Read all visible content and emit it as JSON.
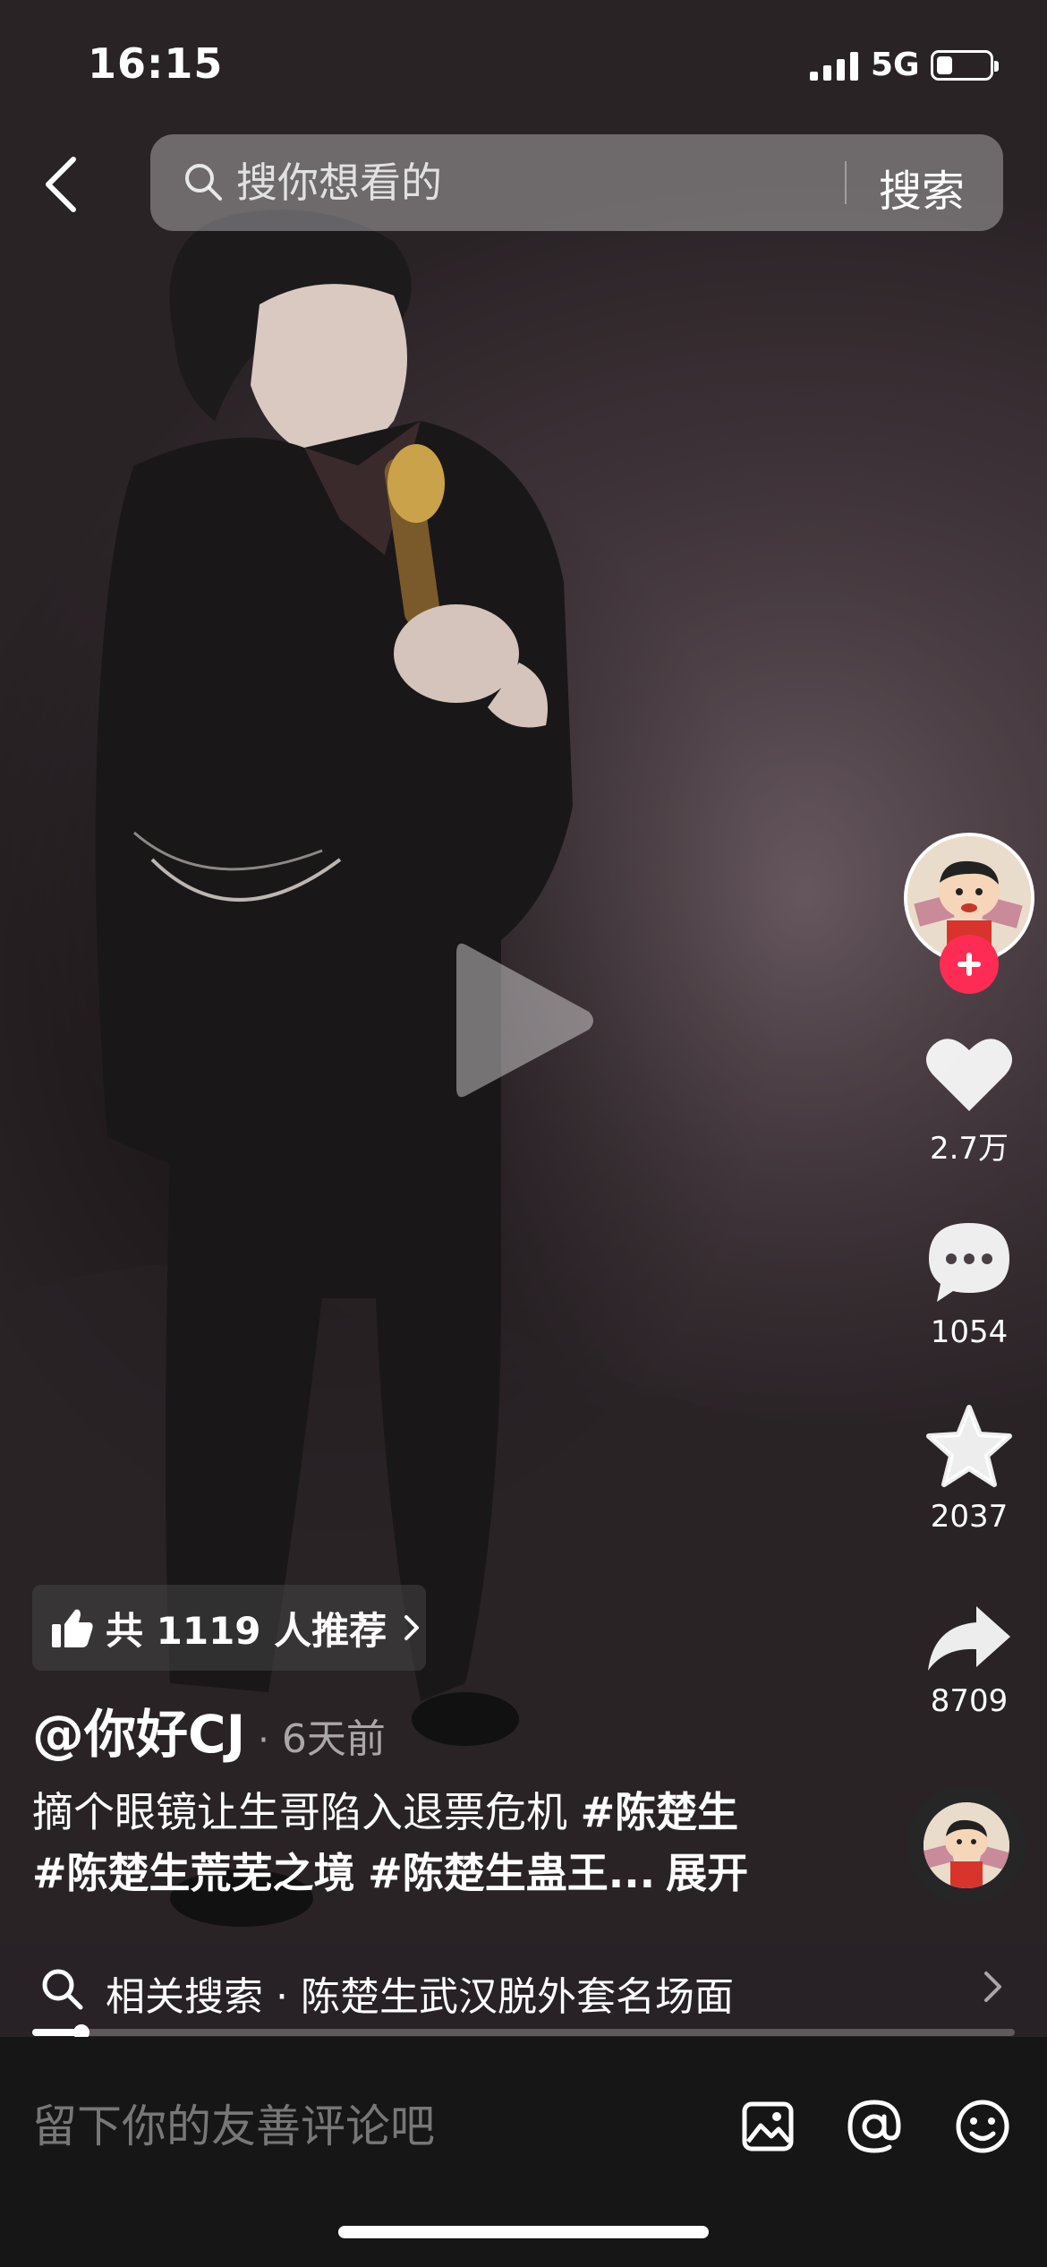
{
  "status_bar": {
    "time": "16:15",
    "network": "5G",
    "battery_level": 0.3
  },
  "search": {
    "placeholder": "搜你想看的",
    "button_label": "搜索"
  },
  "side_actions": {
    "likes": "2.7万",
    "comments": "1054",
    "favorites": "2037",
    "shares": "8709"
  },
  "recommend": {
    "label": "共 1119 人推荐"
  },
  "author": {
    "name": "@你好CJ",
    "separator": "·",
    "date": "6天前"
  },
  "caption": {
    "text": "摘个眼镜让生哥陷入退票危机 ",
    "tags": [
      "#陈楚生",
      "#陈楚生荒芜之境",
      "#陈楚生蛊王..."
    ],
    "expand_label": "展开"
  },
  "related_search": {
    "label": "相关搜索 · 陈楚生武汉脱外套名场面"
  },
  "video_progress": 0.05,
  "comment": {
    "placeholder": "留下你的友善评论吧"
  },
  "colors": {
    "follow": "#fe2c55",
    "background": "#161616"
  }
}
